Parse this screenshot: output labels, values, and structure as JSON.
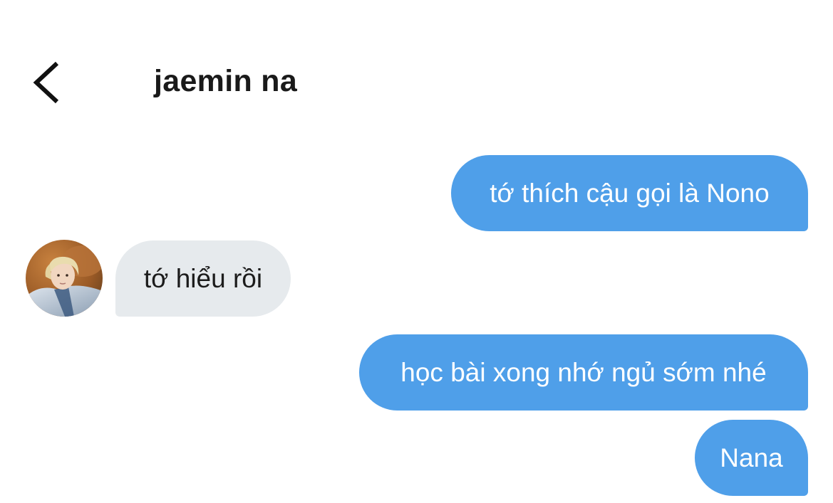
{
  "header": {
    "back_icon": "chevron-left-icon",
    "title": "jaemin na"
  },
  "messages": [
    {
      "sender": "me",
      "text": "tớ thích cậu gọi là Nono"
    },
    {
      "sender": "contact",
      "text": "tớ hiểu rồi",
      "avatar_icon": "avatar-photo"
    },
    {
      "sender": "me",
      "text": "học bài xong nhớ ngủ sớm nhé"
    },
    {
      "sender": "me",
      "text": "Nana"
    }
  ],
  "colors": {
    "sent_bubble": "#4f9fe9",
    "received_bubble": "#e6eaed",
    "sent_text": "#ffffff",
    "received_text": "#1c1c1c",
    "title_text": "#1a1a1a",
    "background": "#ffffff"
  }
}
